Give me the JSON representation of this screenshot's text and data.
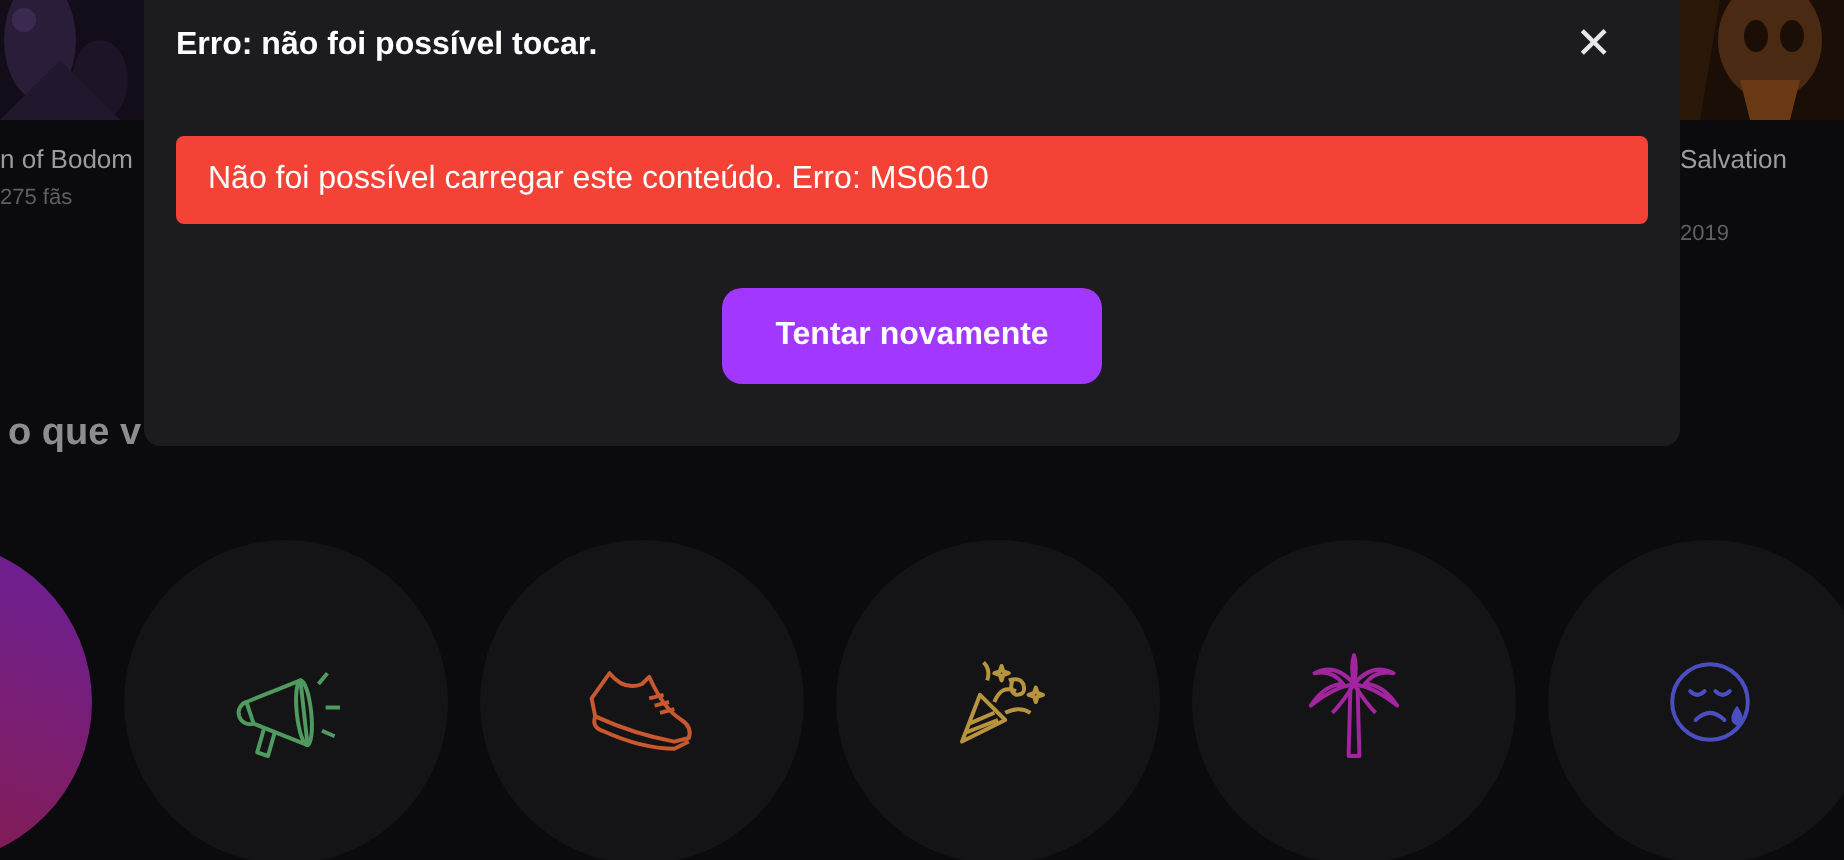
{
  "background": {
    "cards": [
      {
        "title": "n of Bodom",
        "subtitle": "275 fãs"
      },
      {
        "title": "Salvation",
        "subtitle": "2019"
      }
    ],
    "heading": "o que v",
    "categories": [
      {
        "kind": "gradient"
      },
      {
        "kind": "megaphone",
        "color": "#4f9a5e"
      },
      {
        "kind": "sneaker",
        "color": "#c8582e"
      },
      {
        "kind": "party",
        "color": "#b8943e"
      },
      {
        "kind": "palm",
        "color": "#a2249e"
      },
      {
        "kind": "sad",
        "color": "#4a4ec0"
      }
    ]
  },
  "dialog": {
    "title": "Erro: não foi possível tocar.",
    "close": "✕",
    "error": "Não foi possível carregar este conteúdo. Erro: MS0610",
    "button": "Tentar novamente"
  }
}
